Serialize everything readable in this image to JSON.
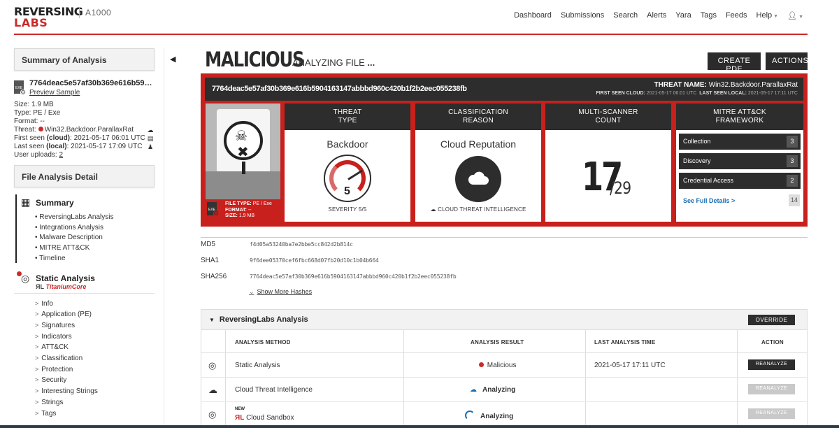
{
  "header": {
    "logo_line1": "REVERSING",
    "logo_line2": "LABS",
    "product": "A1000",
    "nav": [
      "Dashboard",
      "Submissions",
      "Search",
      "Alerts",
      "Yara",
      "Tags",
      "Feeds",
      "Help"
    ]
  },
  "sidebar": {
    "summary_title": "Summary of Analysis",
    "sample_hash": "7764deac5e57af30b369e616b5904...",
    "preview_label": "Preview Sample",
    "exe_label": "EXE",
    "size": "Size: 1.9 MB",
    "type": "Type: PE / Exe",
    "format": "Format: --",
    "threat_prefix": "Threat:",
    "threat_name": "Win32.Backdoor.ParallaxRat",
    "first_seen_prefix": "First seen",
    "first_seen_qual": "(cloud)",
    "first_seen_value": ": 2021-05-17 06:01 UTC",
    "last_seen_prefix": "Last seen",
    "last_seen_qual": "(local)",
    "last_seen_value": ": 2021-05-17 17:09 UTC",
    "uploads_prefix": "User uploads:",
    "uploads_value": "2",
    "file_analysis_title": "File Analysis Detail",
    "summary_section": "Summary",
    "summary_items": [
      "ReversingLabs Analysis",
      "Integrations Analysis",
      "Malware Description",
      "MITRE ATT&CK",
      "Timeline"
    ],
    "static_section": "Static Analysis",
    "titanium_rl": "ЯL",
    "titanium_label": "TitaniumCore",
    "static_items": [
      "Info",
      "Application (PE)",
      "Signatures",
      "Indicators",
      "ATT&CK",
      "Classification",
      "Protection",
      "Security",
      "Interesting Strings",
      "Strings",
      "Tags"
    ]
  },
  "verdict": {
    "label": "MALICIOUS",
    "analyzing": "ANALYZING FILE",
    "ellipsis": "...",
    "create_pdf": "CREATE PDF",
    "actions": "ACTIONS"
  },
  "panel": {
    "sha256": "7764deac5e57af30b369e616b5904163147abbbd960c420b1f2b2eec055238fb",
    "threat_name_label": "THREAT NAME:",
    "threat_name": "Win32.Backdoor.ParallaxRat",
    "first_seen_label": "FIRST SEEN CLOUD:",
    "first_seen": "2021-05-17 06:01 UTC",
    "last_seen_label": "LAST SEEN LOCAL:",
    "last_seen": "2021-05-17 17:11 UTC",
    "file_type_label": "FILE TYPE:",
    "file_type": "PE / Exe",
    "format_label": "FORMAT:",
    "format": "--",
    "size_label": "SIZE:",
    "size": "1.9 MB",
    "exe_label": "EXE",
    "threat_type_head1": "THREAT",
    "threat_type_head2": "TYPE",
    "threat_type": "Backdoor",
    "severity_value": "5",
    "severity_label": "SEVERITY 5/5",
    "class_head1": "CLASSIFICATION",
    "class_head2": "REASON",
    "class_reason": "Cloud Reputation",
    "class_foot": "CLOUD THREAT INTELLIGENCE",
    "scanner_head1": "MULTI-SCANNER",
    "scanner_head2": "COUNT",
    "scanner_detected": "17",
    "scanner_total": "/29",
    "mitre_head1": "MITRE ATT&CK",
    "mitre_head2": "FRAMEWORK",
    "mitre_rows": [
      {
        "label": "Collection",
        "count": "3"
      },
      {
        "label": "Discovery",
        "count": "3"
      },
      {
        "label": "Credential Access",
        "count": "2"
      }
    ],
    "mitre_link": "See Full Details",
    "mitre_link_arrow": ">",
    "mitre_total": "14"
  },
  "hashes": {
    "md5_label": "MD5",
    "md5": "f4d05a53240ba7e2bbe5cc842d2b814c",
    "sha1_label": "SHA1",
    "sha1": "9f6dee05370cef6fbc668d07fb20d10c1b04b664",
    "sha256_label": "SHA256",
    "sha256": "7764deac5e57af30b369e616b5904163147abbbd960c420b1f2b2eec055238fb",
    "show_more": "Show More Hashes"
  },
  "rl_analysis": {
    "title": "ReversingLabs Analysis",
    "override": "OVERRIDE",
    "columns": [
      "ANALYSIS METHOD",
      "ANALYSIS RESULT",
      "LAST ANALYSIS TIME",
      "ACTION"
    ],
    "rows": [
      {
        "method": "Static Analysis",
        "result": "Malicious",
        "time": "2021-05-17 17:11 UTC",
        "action": "REANALYZE"
      },
      {
        "method": "Cloud Threat Intelligence",
        "result": "Analyzing",
        "time": "",
        "action": "REANALYZE"
      },
      {
        "method_rl": "ЯL",
        "method": "Cloud Sandbox",
        "new_tag": "NEW",
        "result": "Analyzing",
        "time": "",
        "action": "REANALYZE"
      }
    ]
  },
  "colors": {
    "accent_red": "#c8201c",
    "dark": "#2d2d2d",
    "link_blue": "#1a6fb3"
  }
}
